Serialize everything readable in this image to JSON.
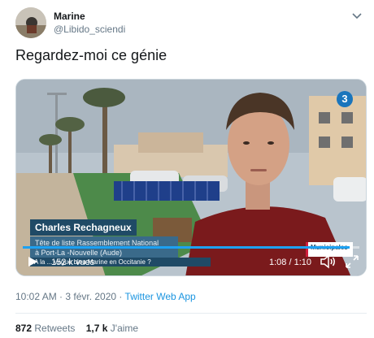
{
  "tweet": {
    "display_name": "Marine",
    "handle": "@Libido_sciendi",
    "text": "Regardez-moi ce génie",
    "timestamp": "10:02 AM · 3 févr. 2020",
    "source_separator": " · ",
    "source": "Twitter Web App",
    "retweets_count": "872",
    "retweets_label": "Retweets",
    "likes_count": "1,7 k",
    "likes_label": "J'aime"
  },
  "video": {
    "channel_logo": "3",
    "lower_third_name": "Charles Rechagneux",
    "lower_third_line1": "Tête de liste Rassemblement National",
    "lower_third_line2": "à Port-La -Nouvelle (Aude)",
    "ticker": "A la ... vague bleu Marine en Occitanie ?",
    "badge": "Municipales",
    "views": "152 k vues",
    "time_current": "1:08",
    "time_separator": " / ",
    "time_total": "1:10",
    "progress_fraction": 0.97
  },
  "colors": {
    "accent": "#1da1f2",
    "link": "#1b95e0",
    "muted": "#657786",
    "lower_third": "#1f4a66"
  },
  "icons": [
    "caret-down-icon",
    "play-icon",
    "volume-icon",
    "fullscreen-icon"
  ]
}
